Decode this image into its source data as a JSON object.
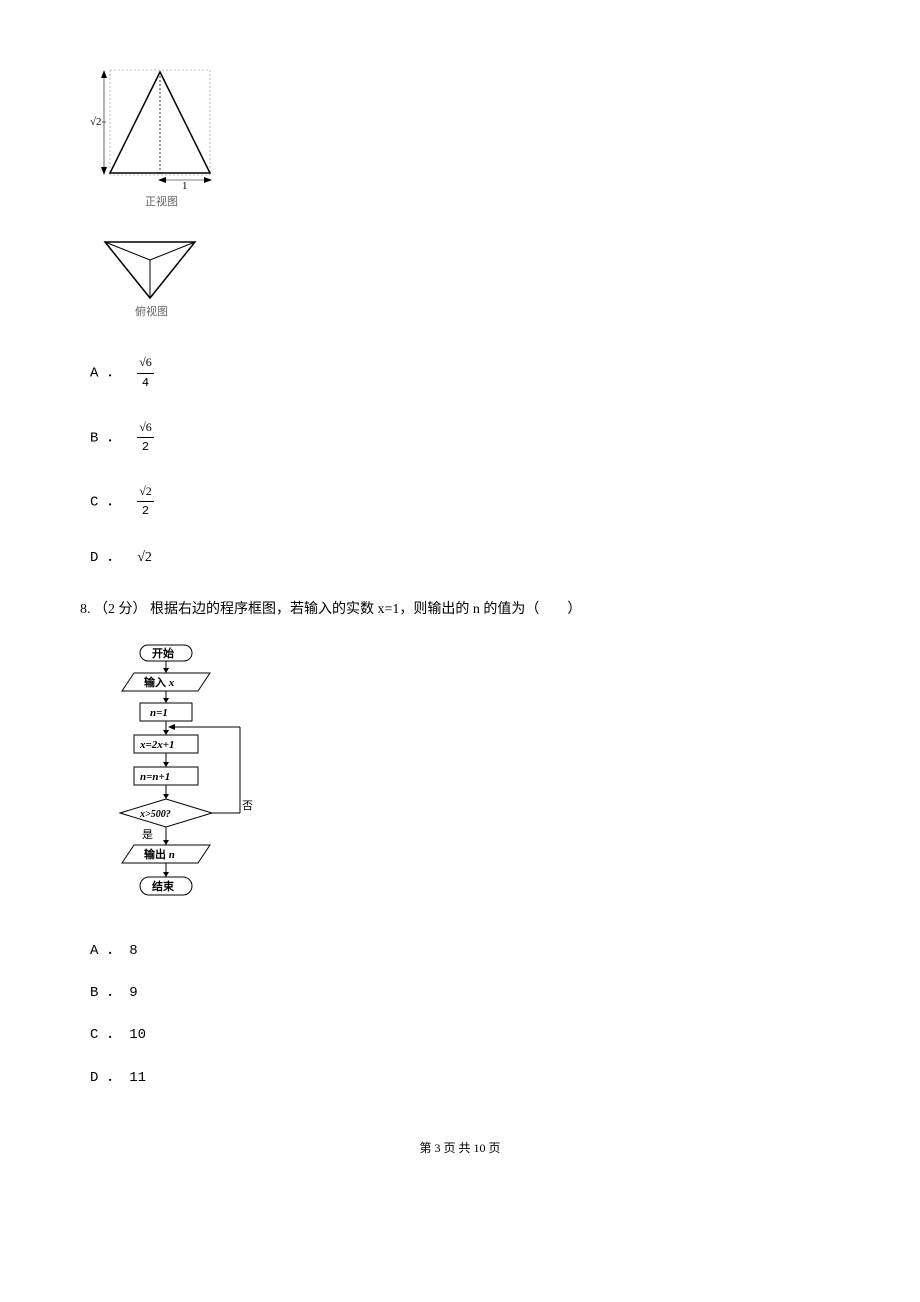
{
  "q7": {
    "front_view_label": "正视图",
    "top_view_label": "俯视图",
    "dimension_height": "√2",
    "dimension_base": "1",
    "options": {
      "a": {
        "label": "A ．",
        "num": "√6",
        "den": "4"
      },
      "b": {
        "label": "B ．",
        "num": "√6",
        "den": "2"
      },
      "c": {
        "label": "C ．",
        "num": "√2",
        "den": "2"
      },
      "d": {
        "label": "D ．",
        "value": "√2"
      }
    }
  },
  "q8": {
    "number": "8.",
    "points": "（2 分）",
    "stem": "根据右边的程序框图，若输入的实数 x=1，则输出的 n 的值为（　　）",
    "flowchart": {
      "start": "开始",
      "input": "输入 x",
      "init": "n=1",
      "step1": "x=2x+1",
      "step2": "n=n+1",
      "cond": "x>500?",
      "no_label": "否",
      "yes_label": "是",
      "output": "输出 n",
      "end": "结束"
    },
    "options": {
      "a": {
        "label": "A ．",
        "value": "8"
      },
      "b": {
        "label": "B ．",
        "value": "9"
      },
      "c": {
        "label": "C ．",
        "value": "10"
      },
      "d": {
        "label": "D ．",
        "value": "11"
      }
    }
  },
  "footer": "第 3 页 共 10 页"
}
